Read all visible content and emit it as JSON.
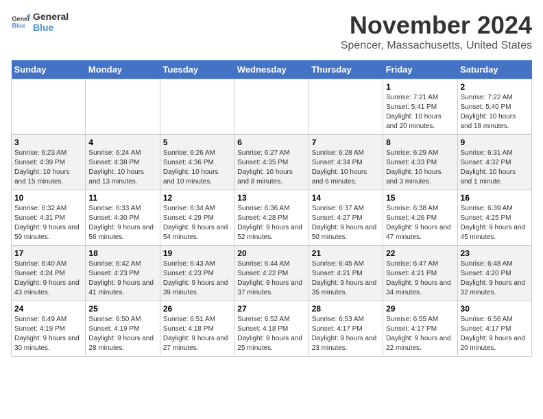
{
  "logo": {
    "line1": "General",
    "line2": "Blue"
  },
  "title": "November 2024",
  "location": "Spencer, Massachusetts, United States",
  "days_of_week": [
    "Sunday",
    "Monday",
    "Tuesday",
    "Wednesday",
    "Thursday",
    "Friday",
    "Saturday"
  ],
  "weeks": [
    [
      {
        "day": "",
        "info": ""
      },
      {
        "day": "",
        "info": ""
      },
      {
        "day": "",
        "info": ""
      },
      {
        "day": "",
        "info": ""
      },
      {
        "day": "",
        "info": ""
      },
      {
        "day": "1",
        "info": "Sunrise: 7:21 AM\nSunset: 5:41 PM\nDaylight: 10 hours and 20 minutes."
      },
      {
        "day": "2",
        "info": "Sunrise: 7:22 AM\nSunset: 5:40 PM\nDaylight: 10 hours and 18 minutes."
      }
    ],
    [
      {
        "day": "3",
        "info": "Sunrise: 6:23 AM\nSunset: 4:39 PM\nDaylight: 10 hours and 15 minutes."
      },
      {
        "day": "4",
        "info": "Sunrise: 6:24 AM\nSunset: 4:38 PM\nDaylight: 10 hours and 13 minutes."
      },
      {
        "day": "5",
        "info": "Sunrise: 6:26 AM\nSunset: 4:36 PM\nDaylight: 10 hours and 10 minutes."
      },
      {
        "day": "6",
        "info": "Sunrise: 6:27 AM\nSunset: 4:35 PM\nDaylight: 10 hours and 8 minutes."
      },
      {
        "day": "7",
        "info": "Sunrise: 6:28 AM\nSunset: 4:34 PM\nDaylight: 10 hours and 6 minutes."
      },
      {
        "day": "8",
        "info": "Sunrise: 6:29 AM\nSunset: 4:33 PM\nDaylight: 10 hours and 3 minutes."
      },
      {
        "day": "9",
        "info": "Sunrise: 6:31 AM\nSunset: 4:32 PM\nDaylight: 10 hours and 1 minute."
      }
    ],
    [
      {
        "day": "10",
        "info": "Sunrise: 6:32 AM\nSunset: 4:31 PM\nDaylight: 9 hours and 59 minutes."
      },
      {
        "day": "11",
        "info": "Sunrise: 6:33 AM\nSunset: 4:30 PM\nDaylight: 9 hours and 56 minutes."
      },
      {
        "day": "12",
        "info": "Sunrise: 6:34 AM\nSunset: 4:29 PM\nDaylight: 9 hours and 54 minutes."
      },
      {
        "day": "13",
        "info": "Sunrise: 6:36 AM\nSunset: 4:28 PM\nDaylight: 9 hours and 52 minutes."
      },
      {
        "day": "14",
        "info": "Sunrise: 6:37 AM\nSunset: 4:27 PM\nDaylight: 9 hours and 50 minutes."
      },
      {
        "day": "15",
        "info": "Sunrise: 6:38 AM\nSunset: 4:26 PM\nDaylight: 9 hours and 47 minutes."
      },
      {
        "day": "16",
        "info": "Sunrise: 6:39 AM\nSunset: 4:25 PM\nDaylight: 9 hours and 45 minutes."
      }
    ],
    [
      {
        "day": "17",
        "info": "Sunrise: 6:40 AM\nSunset: 4:24 PM\nDaylight: 9 hours and 43 minutes."
      },
      {
        "day": "18",
        "info": "Sunrise: 6:42 AM\nSunset: 4:23 PM\nDaylight: 9 hours and 41 minutes."
      },
      {
        "day": "19",
        "info": "Sunrise: 6:43 AM\nSunset: 4:23 PM\nDaylight: 9 hours and 39 minutes."
      },
      {
        "day": "20",
        "info": "Sunrise: 6:44 AM\nSunset: 4:22 PM\nDaylight: 9 hours and 37 minutes."
      },
      {
        "day": "21",
        "info": "Sunrise: 6:45 AM\nSunset: 4:21 PM\nDaylight: 9 hours and 35 minutes."
      },
      {
        "day": "22",
        "info": "Sunrise: 6:47 AM\nSunset: 4:21 PM\nDaylight: 9 hours and 34 minutes."
      },
      {
        "day": "23",
        "info": "Sunrise: 6:48 AM\nSunset: 4:20 PM\nDaylight: 9 hours and 32 minutes."
      }
    ],
    [
      {
        "day": "24",
        "info": "Sunrise: 6:49 AM\nSunset: 4:19 PM\nDaylight: 9 hours and 30 minutes."
      },
      {
        "day": "25",
        "info": "Sunrise: 6:50 AM\nSunset: 4:19 PM\nDaylight: 9 hours and 28 minutes."
      },
      {
        "day": "26",
        "info": "Sunrise: 6:51 AM\nSunset: 4:18 PM\nDaylight: 9 hours and 27 minutes."
      },
      {
        "day": "27",
        "info": "Sunrise: 6:52 AM\nSunset: 4:18 PM\nDaylight: 9 hours and 25 minutes."
      },
      {
        "day": "28",
        "info": "Sunrise: 6:53 AM\nSunset: 4:17 PM\nDaylight: 9 hours and 23 minutes."
      },
      {
        "day": "29",
        "info": "Sunrise: 6:55 AM\nSunset: 4:17 PM\nDaylight: 9 hours and 22 minutes."
      },
      {
        "day": "30",
        "info": "Sunrise: 6:56 AM\nSunset: 4:17 PM\nDaylight: 9 hours and 20 minutes."
      }
    ]
  ]
}
